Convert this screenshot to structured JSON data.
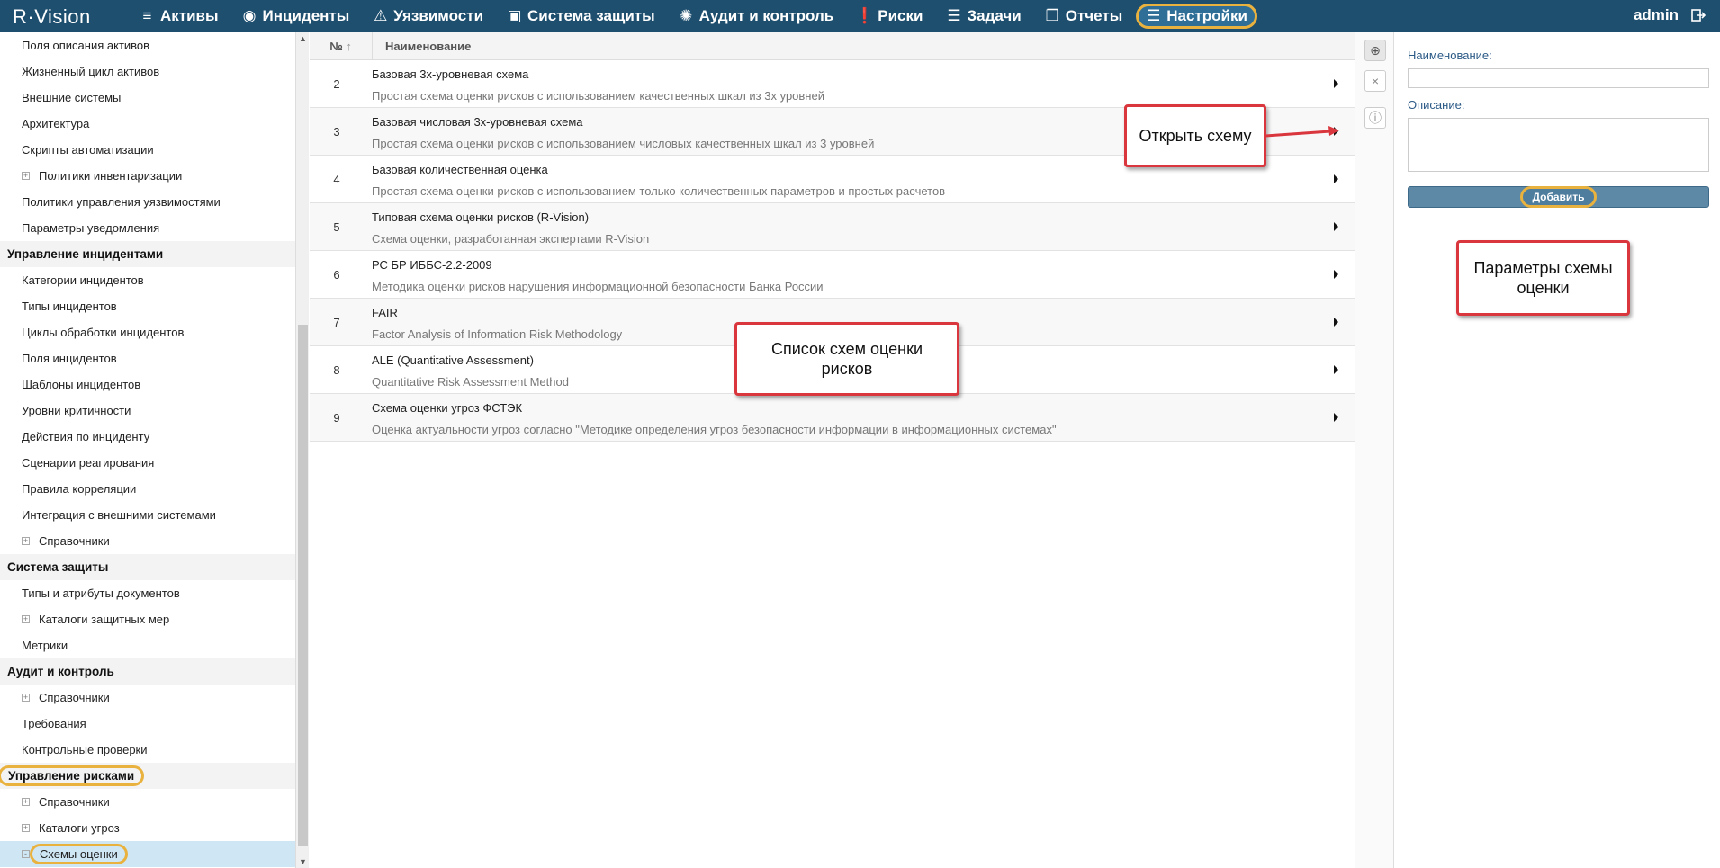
{
  "app": {
    "logo_text": "R·Vision",
    "logo_left": "R",
    "logo_right": "Vision"
  },
  "nav": [
    {
      "label": "Активы",
      "icon": "database-icon"
    },
    {
      "label": "Инциденты",
      "icon": "target-icon"
    },
    {
      "label": "Уязвимости",
      "icon": "warning-icon"
    },
    {
      "label": "Система защиты",
      "icon": "windows-icon"
    },
    {
      "label": "Аудит и контроль",
      "icon": "cycle-icon"
    },
    {
      "label": "Риски",
      "icon": "exclamation-icon"
    },
    {
      "label": "Задачи",
      "icon": "list-icon"
    },
    {
      "label": "Отчеты",
      "icon": "documents-icon"
    },
    {
      "label": "Настройки",
      "icon": "menu-icon",
      "active": true
    }
  ],
  "user": {
    "name": "admin"
  },
  "sidebar": {
    "items": [
      {
        "type": "item",
        "label": "Поля описания активов"
      },
      {
        "type": "item",
        "label": "Жизненный цикл активов"
      },
      {
        "type": "item",
        "label": "Внешние системы"
      },
      {
        "type": "item",
        "label": "Архитектура"
      },
      {
        "type": "item",
        "label": "Скрипты автоматизации"
      },
      {
        "type": "expandable",
        "label": "Политики инвентаризации"
      },
      {
        "type": "item",
        "label": "Политики управления уязвимостями"
      },
      {
        "type": "item",
        "label": "Параметры уведомления"
      },
      {
        "type": "section",
        "label": "Управление инцидентами"
      },
      {
        "type": "item",
        "label": "Категории инцидентов"
      },
      {
        "type": "item",
        "label": "Типы инцидентов"
      },
      {
        "type": "item",
        "label": "Циклы обработки инцидентов"
      },
      {
        "type": "item",
        "label": "Поля инцидентов"
      },
      {
        "type": "item",
        "label": "Шаблоны инцидентов"
      },
      {
        "type": "item",
        "label": "Уровни критичности"
      },
      {
        "type": "item",
        "label": "Действия по инциденту"
      },
      {
        "type": "item",
        "label": "Сценарии реагирования"
      },
      {
        "type": "item",
        "label": "Правила корреляции"
      },
      {
        "type": "item",
        "label": "Интеграция с внешними системами"
      },
      {
        "type": "expandable",
        "label": "Справочники"
      },
      {
        "type": "section",
        "label": "Система защиты"
      },
      {
        "type": "item",
        "label": "Типы и атрибуты документов"
      },
      {
        "type": "expandable",
        "label": "Каталоги защитных мер"
      },
      {
        "type": "item",
        "label": "Метрики"
      },
      {
        "type": "section",
        "label": "Аудит и контроль"
      },
      {
        "type": "expandable",
        "label": "Справочники"
      },
      {
        "type": "item",
        "label": "Требования"
      },
      {
        "type": "item",
        "label": "Контрольные проверки"
      },
      {
        "type": "section",
        "label": "Управление рисками",
        "highlight": true
      },
      {
        "type": "expandable",
        "label": "Справочники"
      },
      {
        "type": "expandable",
        "label": "Каталоги угроз"
      },
      {
        "type": "expandable",
        "label": "Схемы оценки",
        "selected": true,
        "highlight": true
      }
    ]
  },
  "table": {
    "col_no": "№",
    "col_name": "Наименование",
    "rows": [
      {
        "no": "2",
        "title": "Базовая 3х-уровневая схема",
        "desc": "Простая схема оценки рисков с использованием качественных шкал из 3х уровней"
      },
      {
        "no": "3",
        "title": "Базовая числовая 3х-уровневая схема",
        "desc": "Простая схема оценки рисков с использованием числовых качественных шкал из 3 уровней"
      },
      {
        "no": "4",
        "title": "Базовая количественная оценка",
        "desc": "Простая схема оценки рисков с использованием только количественных параметров и простых расчетов"
      },
      {
        "no": "5",
        "title": "Типовая схема оценки рисков (R-Vision)",
        "desc": "Схема оценки, разработанная экспертами R-Vision"
      },
      {
        "no": "6",
        "title": "РС БР ИББС-2.2-2009",
        "desc": "Методика оценки рисков нарушения информационной безопасности Банка России"
      },
      {
        "no": "7",
        "title": "FAIR",
        "desc": "Factor Analysis of Information Risk Methodology"
      },
      {
        "no": "8",
        "title": "ALE (Quantitative Assessment)",
        "desc": "Quantitative Risk Assessment Method"
      },
      {
        "no": "9",
        "title": "Схема оценки угроз ФСТЭК",
        "desc": "Оценка актуальности угроз согласно \"Методике определения угроз безопасности информации в информационных системах\""
      }
    ]
  },
  "form": {
    "name_label": "Наименование:",
    "name_value": "",
    "desc_label": "Описание:",
    "desc_value": "",
    "add_button": "Добавить"
  },
  "callouts": {
    "open_scheme": "Открыть схему",
    "list_line1": "Список схем оценки",
    "list_line2": "рисков",
    "params_line1": "Параметры схемы",
    "params_line2": "оценки"
  },
  "colors": {
    "topbar": "#1f4f6f",
    "highlight": "#e9b23f",
    "callout_border": "#d9363e",
    "selected_row": "#cfe6f5"
  }
}
